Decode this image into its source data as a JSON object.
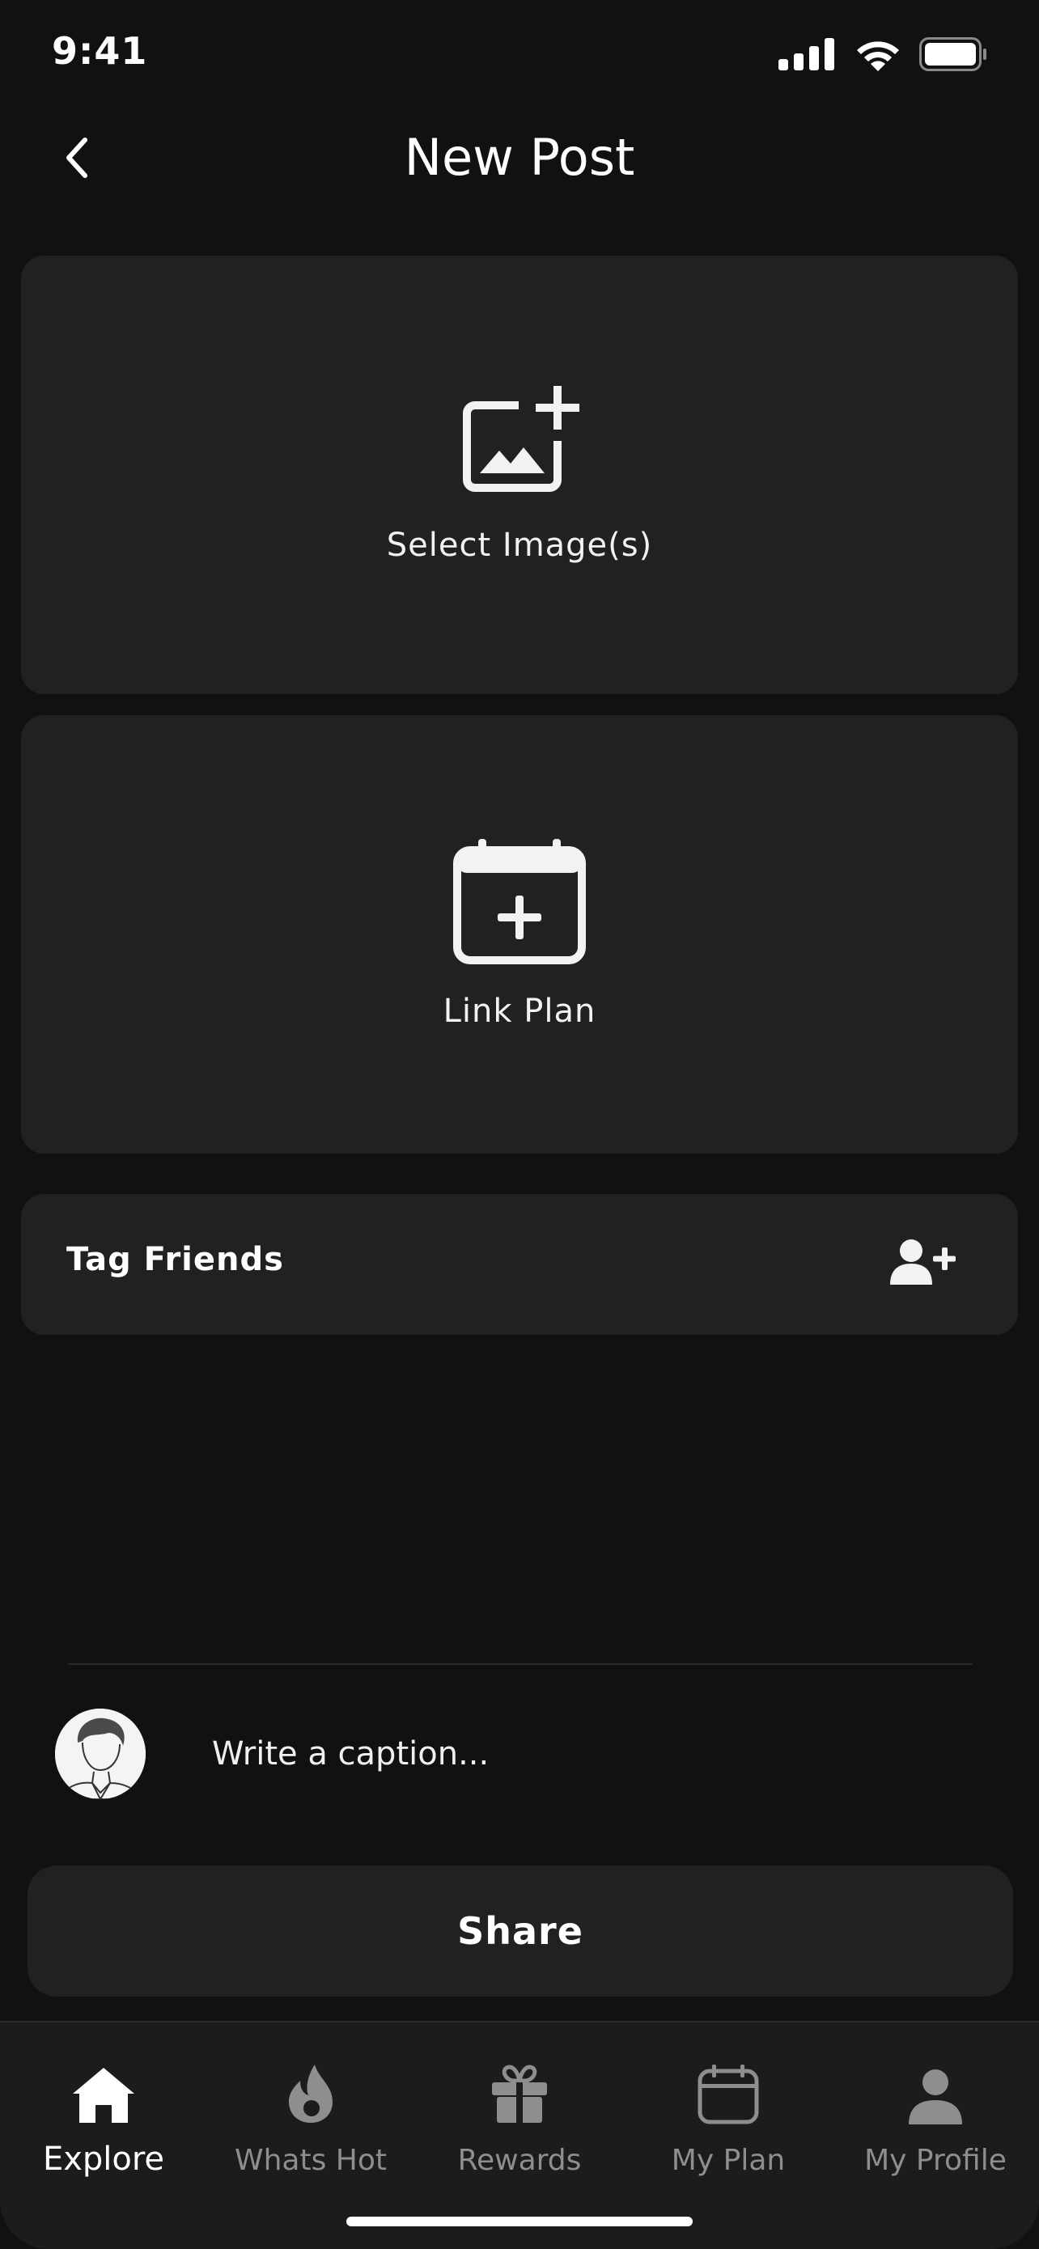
{
  "status_bar": {
    "time": "9:41"
  },
  "header": {
    "title": "New Post",
    "back_icon": "chevron-left-icon"
  },
  "media": {
    "select_image_label": "Select Image(s)",
    "select_image_icon": "image-add-icon",
    "link_plan_label": "Link Plan",
    "link_plan_icon": "calendar-add-icon"
  },
  "tag_friends": {
    "label": "Tag Friends",
    "icon": "user-add-icon"
  },
  "caption": {
    "placeholder": "Write a caption..."
  },
  "share": {
    "label": "Share"
  },
  "tab_bar": {
    "items": [
      {
        "label": "Explore",
        "icon": "home-icon",
        "active": true
      },
      {
        "label": "Whats Hot",
        "icon": "flame-icon",
        "active": false
      },
      {
        "label": "Rewards",
        "icon": "gift-icon",
        "active": false
      },
      {
        "label": "My Plan",
        "icon": "calendar-icon",
        "active": false
      },
      {
        "label": "My Profile",
        "icon": "user-icon",
        "active": false
      }
    ]
  },
  "colors": {
    "background": "#111111",
    "card": "#212123",
    "tab_bar": "#1c1c1e",
    "inactive": "#8e8e8e",
    "text": "#ffffff"
  }
}
